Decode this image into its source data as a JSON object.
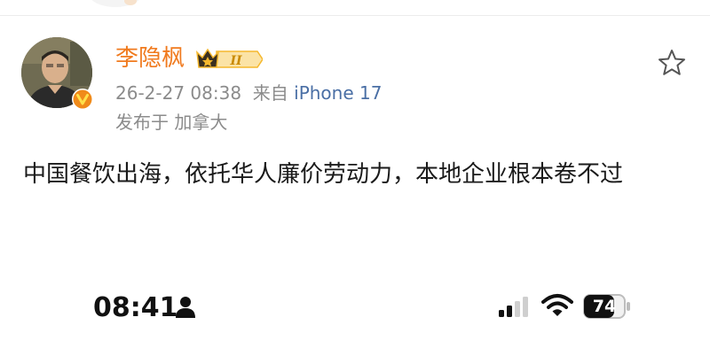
{
  "post": {
    "author": "李隐枫",
    "time": "26-2-27 08:38",
    "source_prefix": "来自",
    "device": "iPhone 17",
    "location": "发布于  加拿大",
    "text": "中国餐饮出海，依托华人廉价劳动力，本地企业根本卷不过",
    "member_badge_level": "II"
  },
  "status_bar": {
    "time": "08:41",
    "battery": "74"
  },
  "colors": {
    "username": "#f07a1e",
    "meta": "#8b8b8b",
    "device_link": "#4a6fa5",
    "badge_gold": "#f5b82e",
    "verified_orange": "#f08a1a"
  },
  "icons": {
    "favorite": "star-outline-icon",
    "verified": "verified-v-icon",
    "member": "crown-member-icon",
    "person": "person-icon",
    "signal": "cellular-signal-icon",
    "wifi": "wifi-icon",
    "battery": "battery-icon"
  }
}
